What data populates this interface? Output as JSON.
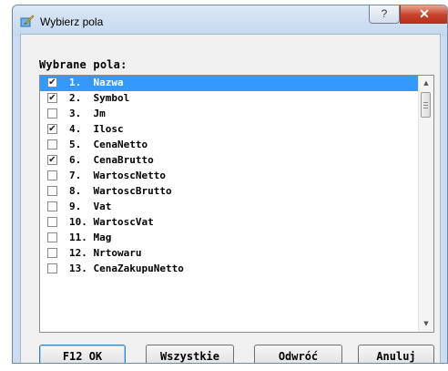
{
  "window": {
    "title": "Wybierz pola",
    "help_glyph": "?",
    "close_glyph": "✕"
  },
  "list": {
    "label": "Wybrane pola:",
    "items": [
      {
        "text": "1.  Nazwa",
        "checked": true,
        "selected": true
      },
      {
        "text": "2.  Symbol",
        "checked": true,
        "selected": false
      },
      {
        "text": "3.  Jm",
        "checked": false,
        "selected": false
      },
      {
        "text": "4.  Ilosc",
        "checked": true,
        "selected": false
      },
      {
        "text": "5.  CenaNetto",
        "checked": false,
        "selected": false
      },
      {
        "text": "6.  CenaBrutto",
        "checked": true,
        "selected": false
      },
      {
        "text": "7.  WartoscNetto",
        "checked": false,
        "selected": false
      },
      {
        "text": "8.  WartoscBrutto",
        "checked": false,
        "selected": false
      },
      {
        "text": "9.  Vat",
        "checked": false,
        "selected": false
      },
      {
        "text": "10. WartoscVat",
        "checked": false,
        "selected": false
      },
      {
        "text": "11. Mag",
        "checked": false,
        "selected": false
      },
      {
        "text": "12. Nrtowaru",
        "checked": false,
        "selected": false
      },
      {
        "text": "13. CenaZakupuNetto",
        "checked": false,
        "selected": false
      }
    ],
    "check_glyph": "✔"
  },
  "scrollbar": {
    "up_glyph": "▲",
    "down_glyph": "▼"
  },
  "buttons": {
    "ok_label": "F12 OK",
    "all_label": "Wszystkie",
    "invert_label": "Odwróć",
    "cancel_label": "Anuluj"
  },
  "colors": {
    "selection": "#3399ff",
    "accent": "#3c7fb1"
  }
}
